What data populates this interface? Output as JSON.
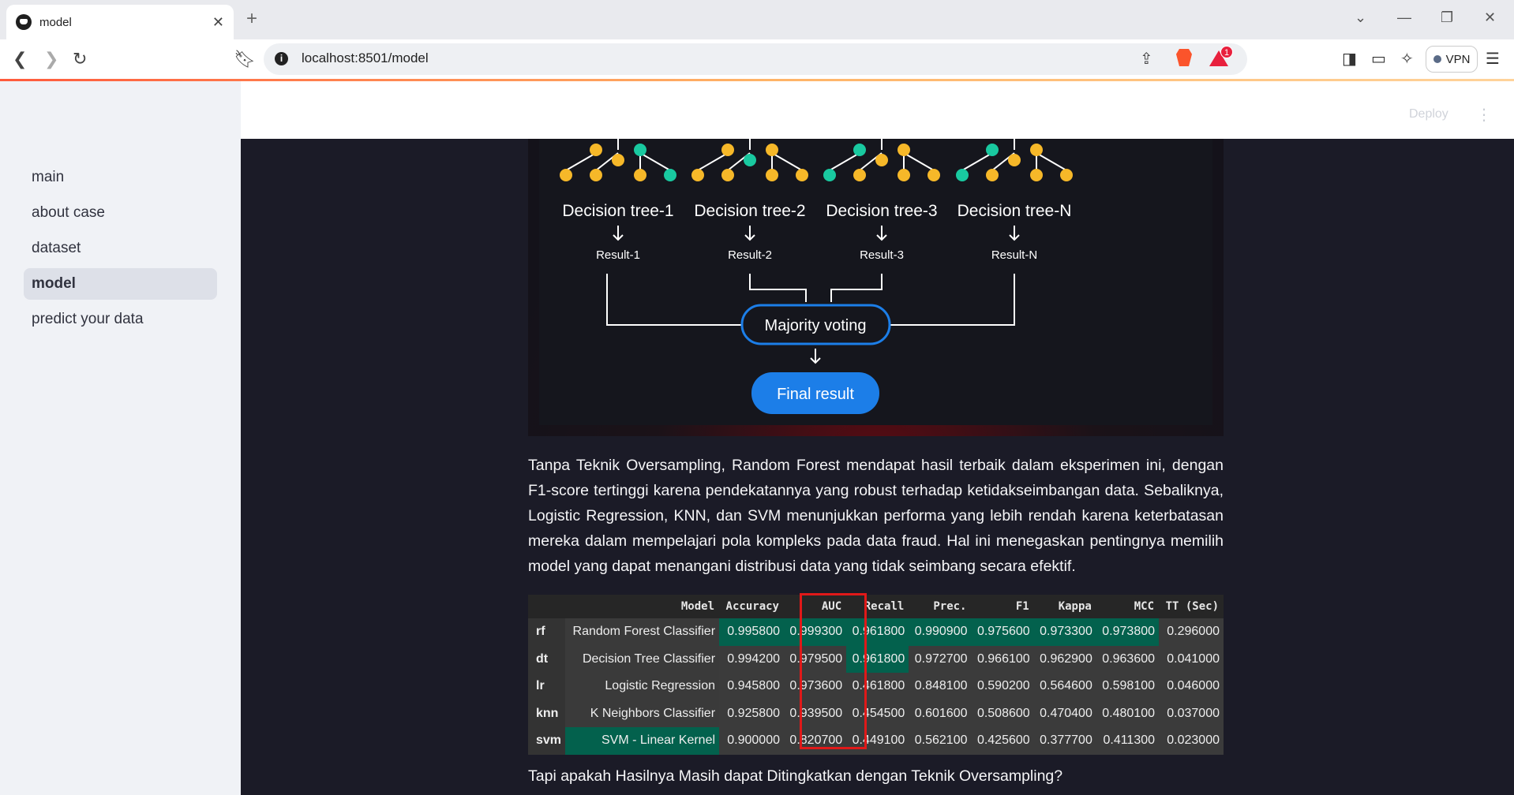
{
  "browser": {
    "tab_title": "model",
    "url": "localhost:8501/model",
    "vpn_label": "VPN",
    "notification_count": "1"
  },
  "sidebar": {
    "items": [
      {
        "label": "main",
        "active": false
      },
      {
        "label": "about case",
        "active": false
      },
      {
        "label": "dataset",
        "active": false
      },
      {
        "label": "model",
        "active": true
      },
      {
        "label": "predict your data",
        "active": false
      }
    ]
  },
  "header": {
    "deploy_label": "Deploy"
  },
  "diagram": {
    "trees": [
      "Decision tree-1",
      "Decision tree-2",
      "Decision tree-3",
      "Decision tree-N"
    ],
    "results": [
      "Result-1",
      "Result-2",
      "Result-3",
      "Result-N"
    ],
    "voting_label": "Majority voting",
    "final_label": "Final result",
    "colors": {
      "yellow": "#f6b829",
      "teal": "#19c9a0",
      "blue": "#1c7ee8"
    }
  },
  "content": {
    "paragraph": "Tanpa Teknik Oversampling, Random Forest mendapat hasil terbaik dalam eksperimen ini, dengan F1-score tertinggi karena pendekatannya yang robust terhadap ketidakseimbangan data. Sebaliknya, Logistic Regression, KNN, dan SVM menunjukkan performa yang lebih rendah karena keterbatasan mereka dalam mempelajari pola kompleks pada data fraud. Hal ini menegaskan pentingnya memilih model yang dapat menangani distribusi data yang tidak seimbang secara efektif.",
    "question": "Tapi apakah Hasilnya Masih dapat Ditingkatkan dengan Teknik Oversampling?"
  },
  "table": {
    "headers": [
      "",
      "Model",
      "Accuracy",
      "AUC",
      "Recall",
      "Prec.",
      "F1",
      "Kappa",
      "MCC",
      "TT (Sec)"
    ],
    "rows": [
      {
        "idx": "rf",
        "model": "Random Forest Classifier",
        "values": [
          "0.995800",
          "0.999300",
          "0.961800",
          "0.990900",
          "0.975600",
          "0.973300",
          "0.973800",
          "0.296000"
        ]
      },
      {
        "idx": "dt",
        "model": "Decision Tree Classifier",
        "values": [
          "0.994200",
          "0.979500",
          "0.961800",
          "0.972700",
          "0.966100",
          "0.962900",
          "0.963600",
          "0.041000"
        ]
      },
      {
        "idx": "lr",
        "model": "Logistic Regression",
        "values": [
          "0.945800",
          "0.973600",
          "0.461800",
          "0.848100",
          "0.590200",
          "0.564600",
          "0.598100",
          "0.046000"
        ]
      },
      {
        "idx": "knn",
        "model": "K Neighbors Classifier",
        "values": [
          "0.925800",
          "0.939500",
          "0.454500",
          "0.601600",
          "0.508600",
          "0.470400",
          "0.480100",
          "0.037000"
        ]
      },
      {
        "idx": "svm",
        "model": "SVM - Linear Kernel",
        "values": [
          "0.900000",
          "0.820700",
          "0.449100",
          "0.562100",
          "0.425600",
          "0.377700",
          "0.411300",
          "0.023000"
        ]
      }
    ],
    "highlight_color": "#03614d",
    "highlight_box_color": "#e01919"
  }
}
